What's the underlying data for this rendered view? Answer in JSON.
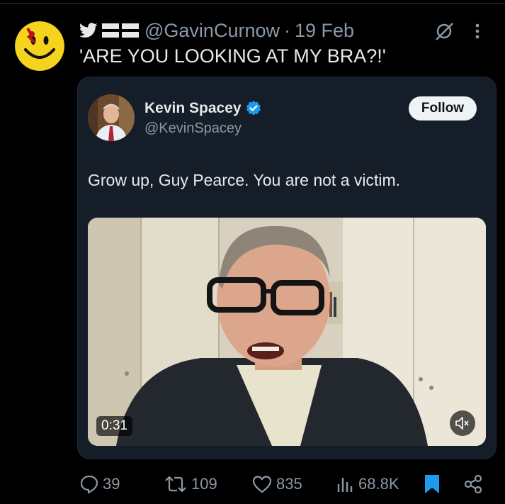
{
  "author": {
    "handle": "@GavinCurnow",
    "date": "19 Feb"
  },
  "tweet": {
    "text": "'ARE YOU LOOKING AT MY BRA?!'"
  },
  "quoted": {
    "name": "Kevin Spacey",
    "handle": "@KevinSpacey",
    "follow_label": "Follow",
    "text": "Grow up, Guy Pearce. You are not a victim.",
    "video": {
      "duration": "0:31"
    }
  },
  "actions": {
    "replies": "39",
    "retweets": "109",
    "likes": "835",
    "views": "68.8K"
  },
  "colors": {
    "background": "#000000",
    "text": "#e7e9ea",
    "muted": "#8b98a5",
    "card": "#151d29",
    "verified": "#1d9bf0",
    "bookmark": "#1d9bf0",
    "smiley": "#f6d31c"
  },
  "icons": {
    "twitter": "twitter-bird-icon",
    "flag": "flag-icon",
    "grok": "grok-icon",
    "more": "more-icon",
    "verified": "verified-badge-icon",
    "mute": "mute-icon",
    "reply": "reply-icon",
    "retweet": "retweet-icon",
    "like": "heart-icon",
    "views": "views-icon",
    "bookmark": "bookmark-icon",
    "share": "share-icon"
  }
}
